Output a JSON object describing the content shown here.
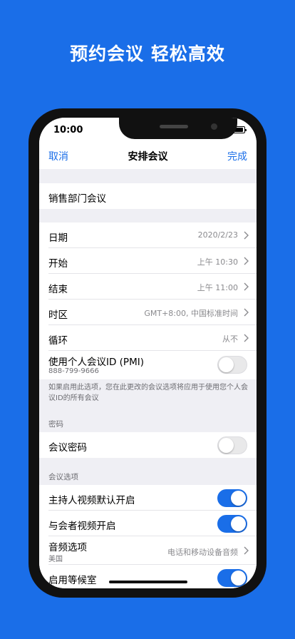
{
  "headline": "预约会议 轻松高效",
  "status": {
    "time": "10:00"
  },
  "nav": {
    "cancel": "取消",
    "title": "安排会议",
    "done": "完成"
  },
  "topic": "销售部门会议",
  "rows": {
    "date": {
      "label": "日期",
      "value": "2020/2/23"
    },
    "start": {
      "label": "开始",
      "value": "上午 10:30"
    },
    "end": {
      "label": "结束",
      "value": "上午 11:00"
    },
    "timezone": {
      "label": "时区",
      "value": "GMT+8:00, 中国标准时间"
    },
    "repeat": {
      "label": "循环",
      "value": "从不"
    },
    "pmi": {
      "label": "使用个人会议ID (PMI)",
      "sub": "888-799-9666",
      "on": false
    }
  },
  "pmi_note": "如果启用此选项，您在此更改的会议选项将应用于使用您个人会议ID的所有会议",
  "password_section": {
    "header": "密码",
    "label": "会议密码",
    "on": false
  },
  "options_section": {
    "header": "会议选项",
    "host_video": {
      "label": "主持人视频默认开启",
      "on": true
    },
    "participant_video": {
      "label": "与会者视频开启",
      "on": true
    },
    "audio": {
      "label": "音频选项",
      "sub": "美国",
      "value": "电话和移动设备音频"
    },
    "waiting_room": {
      "label": "启用等候室",
      "on": true
    }
  },
  "colors": {
    "accent": "#1a6ee8",
    "background": "#1a6ee8"
  },
  "icons": [
    "wifi-icon",
    "battery-icon",
    "chevron-right-icon"
  ]
}
